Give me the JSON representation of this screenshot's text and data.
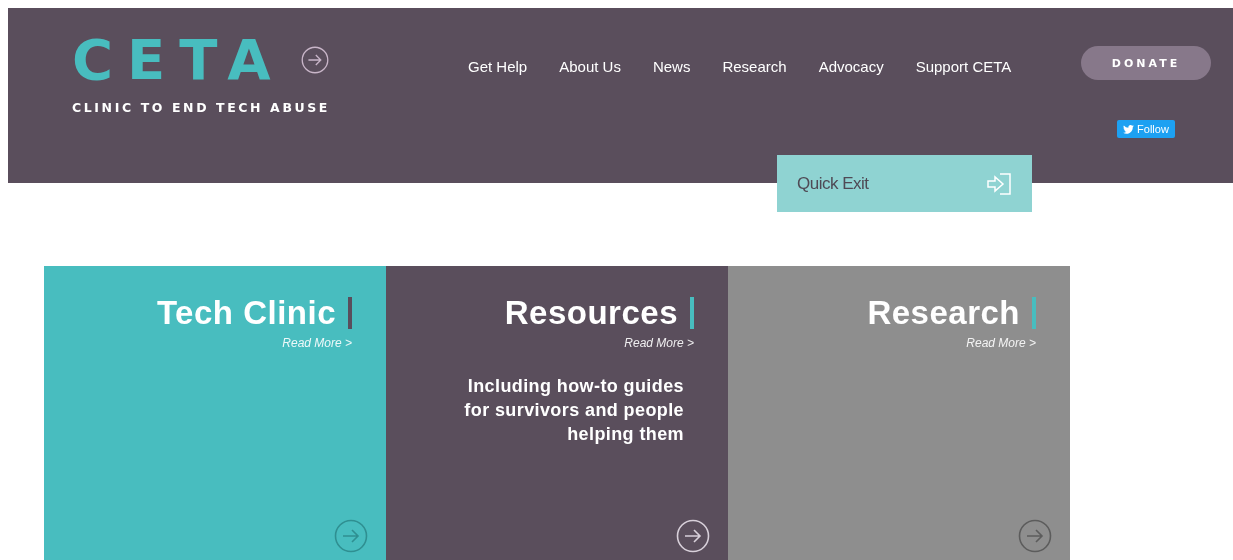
{
  "header": {
    "logo": "CETA",
    "tagline": "CLINIC TO END TECH ABUSE",
    "nav": [
      "Get Help",
      "About Us",
      "News",
      "Research",
      "Advocacy",
      "Support CETA"
    ],
    "donate": "DONATE",
    "follow": "Follow"
  },
  "quick_exit": "Quick Exit",
  "cards": [
    {
      "title": "Tech Clinic",
      "link": "Read More >",
      "color": "#48bdbf",
      "accent": {
        "color": "#5a4e5c"
      }
    },
    {
      "title": "Resources",
      "link": "Read More >",
      "description": "Including how-to guides for survivors and people helping them",
      "color": "#5a4e5c",
      "accent": {
        "color": "#48bdbf"
      }
    },
    {
      "title": "Research",
      "link": "Read More >",
      "color": "#8e8e8e",
      "accent": {
        "color": "#48bdbf"
      }
    }
  ]
}
